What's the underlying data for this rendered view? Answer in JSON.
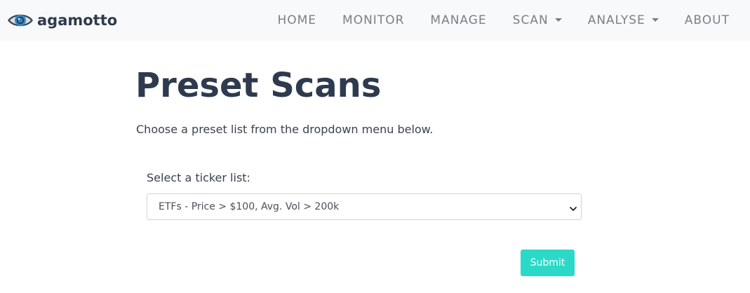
{
  "brand": {
    "name": "agamotto",
    "icon": "eye-icon"
  },
  "nav": {
    "items": [
      {
        "label": "HOME"
      },
      {
        "label": "MONITOR"
      },
      {
        "label": "MANAGE"
      },
      {
        "label": "SCAN",
        "dropdown": true
      },
      {
        "label": "ANALYSE",
        "dropdown": true
      },
      {
        "label": "ABOUT"
      }
    ]
  },
  "main": {
    "title": "Preset Scans",
    "description": "Choose a preset list from the dropdown menu below.",
    "form": {
      "label": "Select a ticker list:",
      "selected_value": "ETFs - Price > $100, Avg. Vol > 200k",
      "submit_label": "Submit"
    }
  },
  "colors": {
    "navbar_bg": "#f8f9fa",
    "brand_text": "#2e3a4e",
    "nav_text": "#7b7f84",
    "title_text": "#2e3a4e",
    "submit_bg": "#2bd9c8",
    "eye_iris": "#2a8fd6"
  }
}
